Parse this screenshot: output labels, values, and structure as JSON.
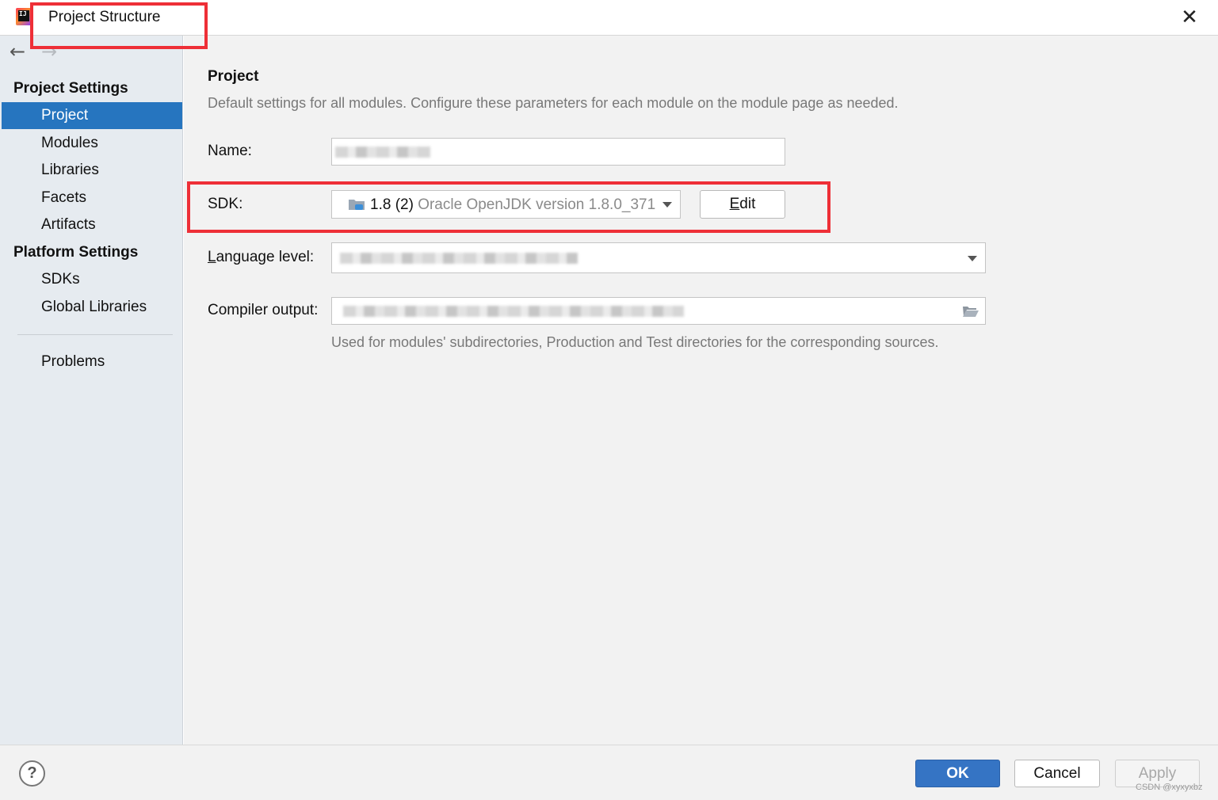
{
  "window": {
    "title": "Project Structure",
    "close_glyph": "✕"
  },
  "sidebar": {
    "back_glyph": "←",
    "forward_glyph": "→",
    "sections": [
      {
        "header": "Project Settings",
        "items": [
          "Project",
          "Modules",
          "Libraries",
          "Facets",
          "Artifacts"
        ]
      },
      {
        "header": "Platform Settings",
        "items": [
          "SDKs",
          "Global Libraries"
        ]
      }
    ],
    "problems": "Problems",
    "selected": "Project"
  },
  "main": {
    "heading": "Project",
    "description": "Default settings for all modules. Configure these parameters for each module on the module page as needed.",
    "name": {
      "label": "Name:",
      "value": ""
    },
    "sdk": {
      "label": "SDK:",
      "version": "1.8 (2)",
      "detail": "Oracle OpenJDK version 1.8.0_371",
      "edit_label": "Edit",
      "edit_mnemonic": "E",
      "edit_rest": "dit"
    },
    "language_level": {
      "label": "Language level:",
      "label_mnemonic": "L",
      "label_rest": "anguage level:",
      "value": ""
    },
    "compiler_output": {
      "label": "Compiler output:",
      "value": "",
      "hint": "Used for modules' subdirectories, Production and Test directories for the corresponding sources."
    }
  },
  "footer": {
    "help_label": "?",
    "ok_label": "OK",
    "cancel_label": "Cancel",
    "apply_label": "Apply",
    "watermark": "CSDN @xyxyxbz"
  },
  "icons": {
    "app": "intellij-idea-icon",
    "sdk": "jdk-folder-icon",
    "browse": "folder-open-icon"
  },
  "colors": {
    "selection": "#2675bf",
    "ok_button": "#3574c4",
    "highlight_box": "#ee2f37"
  }
}
